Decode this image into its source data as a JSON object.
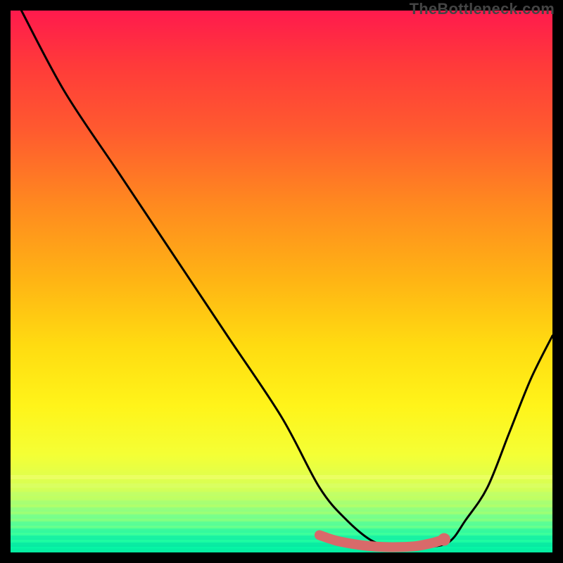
{
  "watermark": "TheBottleneck.com",
  "chart_data": {
    "type": "line",
    "title": "",
    "xlabel": "",
    "ylabel": "",
    "xlim": [
      0,
      100
    ],
    "ylim": [
      0,
      100
    ],
    "grid": false,
    "series": [
      {
        "name": "bottleneck-curve",
        "color": "#000000",
        "x": [
          2,
          10,
          20,
          30,
          40,
          50,
          57,
          62,
          67,
          72,
          77,
          81,
          84,
          88,
          92,
          96,
          100
        ],
        "values": [
          100,
          85,
          70,
          55,
          40,
          25,
          12,
          6,
          2,
          1,
          1,
          2,
          6,
          12,
          22,
          32,
          40
        ]
      }
    ],
    "highlight": {
      "name": "optimal-range",
      "color": "#d86a6a",
      "x": [
        57,
        60,
        63,
        66,
        69,
        72,
        75,
        78,
        80
      ],
      "values": [
        3.2,
        2.2,
        1.6,
        1.2,
        1.0,
        1.0,
        1.2,
        1.8,
        2.4
      ]
    },
    "marker": {
      "x": 80,
      "y": 2.4,
      "r": 1.2,
      "color": "#d86a6a"
    }
  },
  "colors": {
    "gradient_top": "#ff1a4d",
    "gradient_bottom": "#05e9a0",
    "curve": "#000000",
    "highlight": "#d86a6a",
    "frame": "#000000"
  }
}
